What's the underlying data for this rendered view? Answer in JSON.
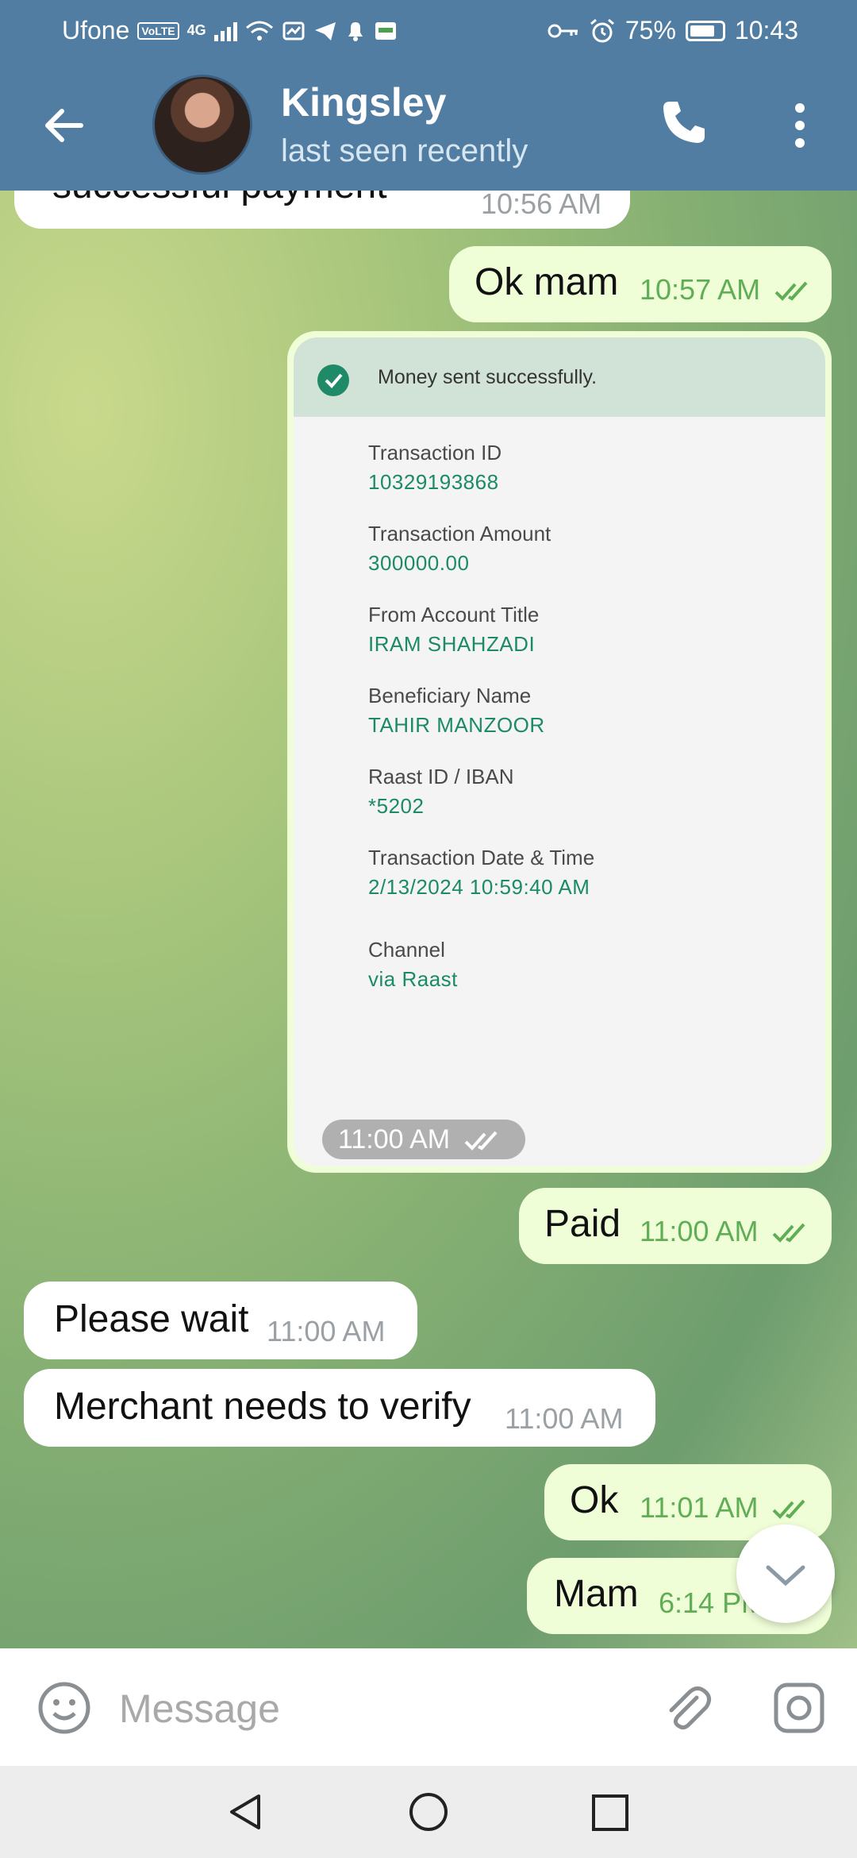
{
  "status_bar": {
    "carrier": "Ufone",
    "volte": "VoLTE",
    "network": "4G",
    "battery": "75%",
    "time": "10:43"
  },
  "header": {
    "contact_name": "Kingsley",
    "last_seen": "last seen recently",
    "icons": [
      "back-arrow-icon",
      "phone-icon",
      "more-vert-icon"
    ]
  },
  "messages": {
    "m0": {
      "text": "successful payment",
      "time": "10:56 AM"
    },
    "m1": {
      "text": "Ok mam",
      "time": "10:57 AM"
    },
    "m3": {
      "text": "Paid",
      "time": "11:00 AM"
    },
    "m4": {
      "text": "Please wait",
      "time": "11:00 AM"
    },
    "m5": {
      "text": "Merchant needs to verify",
      "time": "11:00 AM"
    },
    "m6": {
      "text": "Ok",
      "time": "11:01 AM"
    },
    "m7": {
      "text": "Mam",
      "time": "6:14 PM"
    }
  },
  "receipt": {
    "header": "Money sent successfully.",
    "time": "11:00 AM",
    "fields": [
      {
        "label": "Transaction ID",
        "value": "10329193868"
      },
      {
        "label": "Transaction Amount",
        "value": "300000.00"
      },
      {
        "label": "From Account Title",
        "value": "IRAM SHAHZADI"
      },
      {
        "label": "Beneficiary Name",
        "value": "TAHIR MANZOOR"
      },
      {
        "label": "Raast ID / IBAN",
        "value": "*5202"
      },
      {
        "label": "Transaction Date & Time",
        "value": "2/13/2024 10:59:40 AM"
      },
      {
        "label": "Channel",
        "value": "via Raast"
      }
    ]
  },
  "composer": {
    "placeholder": "Message"
  },
  "colors": {
    "header_bg": "#517da2",
    "outgoing_bubble": "#f0fed8",
    "incoming_bubble": "#ffffff",
    "time_out": "#5fae55",
    "receipt_value": "#1b8a66"
  }
}
